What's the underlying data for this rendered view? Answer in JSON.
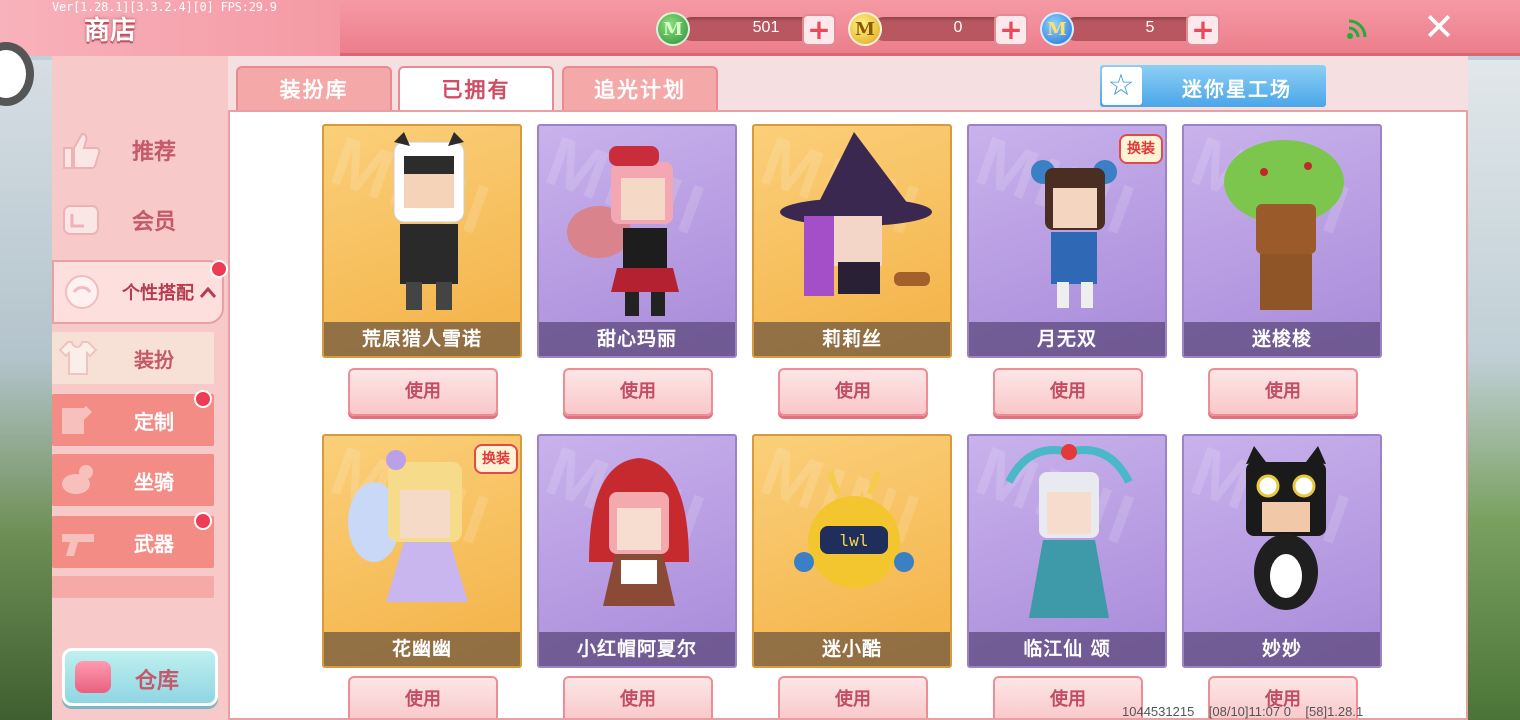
{
  "topbar": {
    "debug": "Ver[1.28.1][3.3.2.4][0] FPS:29.9",
    "title": "商店",
    "currencies": [
      {
        "name": "green-gem",
        "symbol": "M",
        "amount": "501",
        "color": "#3a9a45"
      },
      {
        "name": "gold-coin",
        "symbol": "M",
        "amount": "0",
        "color": "#e8b21f"
      },
      {
        "name": "blue-coin",
        "symbol": "M",
        "amount": "5",
        "color": "#2a7be0"
      }
    ],
    "plus": "+",
    "close": "✕"
  },
  "sidebar": {
    "items": [
      {
        "label": "推荐",
        "icon": "thumbs-up-icon"
      },
      {
        "label": "会员",
        "icon": "vip-card-icon"
      },
      {
        "label": "个性搭配",
        "icon": "style-icon",
        "expanded": true,
        "arrow": "^"
      }
    ],
    "subitems": [
      {
        "label": "装扮",
        "icon": "shirt-icon",
        "selected": true,
        "dot": false
      },
      {
        "label": "定制",
        "icon": "customize-icon",
        "selected": false,
        "dot": true
      },
      {
        "label": "坐骑",
        "icon": "mount-icon",
        "selected": false,
        "dot": false
      },
      {
        "label": "武器",
        "icon": "gun-icon",
        "selected": false,
        "dot": true
      }
    ],
    "warehouse": "仓库"
  },
  "tabs": [
    {
      "label": "装扮库",
      "active": false
    },
    {
      "label": "已拥有",
      "active": true
    },
    {
      "label": "追光计划",
      "active": false
    }
  ],
  "studio_button": "迷你星工场",
  "card_watermark": "MINI",
  "swap_label": "换装",
  "use_label": "使用",
  "cards": [
    {
      "name": "荒原猎人雪诺",
      "bg": "gold",
      "swap": false
    },
    {
      "name": "甜心玛丽",
      "bg": "purple",
      "swap": false
    },
    {
      "name": "莉莉丝",
      "bg": "gold",
      "swap": false
    },
    {
      "name": "月无双",
      "bg": "purple",
      "swap": true
    },
    {
      "name": "迷梭梭",
      "bg": "purple",
      "swap": false
    },
    {
      "name": "花幽幽",
      "bg": "gold",
      "swap": true
    },
    {
      "name": "小红帽阿夏尔",
      "bg": "purple",
      "swap": false
    },
    {
      "name": "迷小酷",
      "bg": "gold",
      "swap": false
    },
    {
      "name": "临江仙 颂",
      "bg": "purple",
      "swap": false
    },
    {
      "name": "妙妙",
      "bg": "purple",
      "swap": false
    }
  ],
  "footer": {
    "uid": "1044531215",
    "time": "[08/10]11:07 0",
    "version": "[58]1.28.1"
  }
}
